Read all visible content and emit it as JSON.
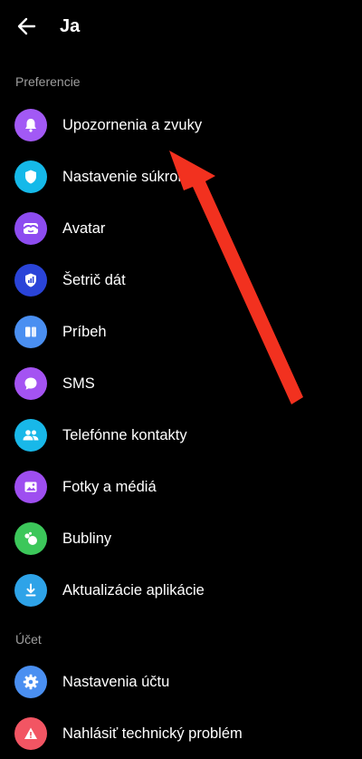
{
  "header": {
    "title": "Ja"
  },
  "sections": {
    "preferences_label": "Preferencie",
    "account_label": "Účet"
  },
  "items": [
    {
      "label": "Upozornenia a zvuky",
      "icon": "bell-icon",
      "color": "#a259f5"
    },
    {
      "label": "Nastavenie súkromia",
      "icon": "shield-icon",
      "color": "#15b9e9"
    },
    {
      "label": "Avatar",
      "icon": "avatar-icon",
      "color": "#8d4cf0"
    },
    {
      "label": "Šetrič dát",
      "icon": "data-saver-icon",
      "color": "#2a44d8"
    },
    {
      "label": "Príbeh",
      "icon": "story-icon",
      "color": "#4a8ff1"
    },
    {
      "label": "SMS",
      "icon": "chat-bubble-icon",
      "color": "#a453f2"
    },
    {
      "label": "Telefónne kontakty",
      "icon": "contacts-icon",
      "color": "#18b8e9"
    },
    {
      "label": "Fotky a médiá",
      "icon": "photo-icon",
      "color": "#9e4ef0"
    },
    {
      "label": "Bubliny",
      "icon": "bubbles-icon",
      "color": "#3cc75a"
    },
    {
      "label": "Aktualizácie aplikácie",
      "icon": "download-icon",
      "color": "#2ea3e8"
    },
    {
      "label": "Nastavenia účtu",
      "icon": "gear-icon",
      "color": "#4a8ff1"
    },
    {
      "label": "Nahlásiť technický problém",
      "icon": "warning-icon",
      "color": "#f25563"
    }
  ],
  "annotation": {
    "arrow_color": "#f2311f"
  }
}
